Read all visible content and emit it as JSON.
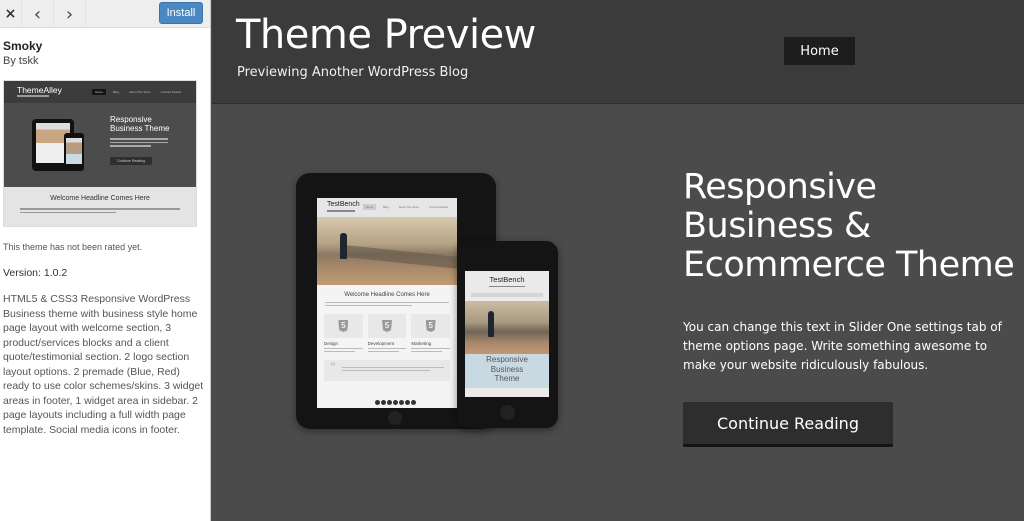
{
  "toolbar": {
    "close_icon": "×",
    "prev_icon": "‹",
    "next_icon": "›",
    "install_label": "Install"
  },
  "theme": {
    "name": "Smoky",
    "author": "By tskk",
    "rating_text": "This theme has not been rated yet.",
    "version": "Version: 1.0.2",
    "description": "HTML5 & CSS3 Responsive WordPress Business theme with business style home page layout with welcome section, 3 product/services blocks and a client quote/testimonial section. 2 logo section layout options. 2 premade (Blue, Red) ready to use color schemes/skins. 3 widget areas in footer, 1 widget area in sidebar. 2 page layouts including a full width page template. Social media icons in footer."
  },
  "thumbnail": {
    "logo": "ThemeAlley",
    "nav": [
      "Home",
      "Blog",
      "About The Store",
      "Contact Details"
    ],
    "hero_title": "Responsive Business Theme",
    "button": "Continue Reading",
    "welcome_headline": "Welcome Headline Comes Here"
  },
  "preview": {
    "site_title": "Theme Preview",
    "tagline": "Previewing Another WordPress Blog",
    "nav_home": "Home",
    "hero_title_line1": "Responsive",
    "hero_title_line2": "Business &",
    "hero_title_line3": "Ecommerce Theme",
    "hero_text": "You can change this text in Slider One settings tab of theme options page. Write something awesome to make your website ridiculously fabulous.",
    "cta_label": "Continue Reading",
    "tablet": {
      "logo": "TestBench",
      "nav": [
        "Home",
        "Blog",
        "About The Store",
        "Contact Details"
      ],
      "welcome_headline": "Welcome Headline Comes Here",
      "features": [
        {
          "icon": "5",
          "label": "Design"
        },
        {
          "icon": "5",
          "label": "Development"
        },
        {
          "icon": "5",
          "label": "Marketing"
        }
      ],
      "quote_mark": "“"
    },
    "phone": {
      "logo": "TestBench",
      "hero_line1": "Responsive",
      "hero_line2": "Business",
      "hero_line3": "Theme"
    }
  },
  "colors": {
    "install_button": "#4a88c4",
    "header_bg": "#3b3b3b",
    "body_bg": "#4b4b4b",
    "nav_active": "#1d1d1d"
  }
}
